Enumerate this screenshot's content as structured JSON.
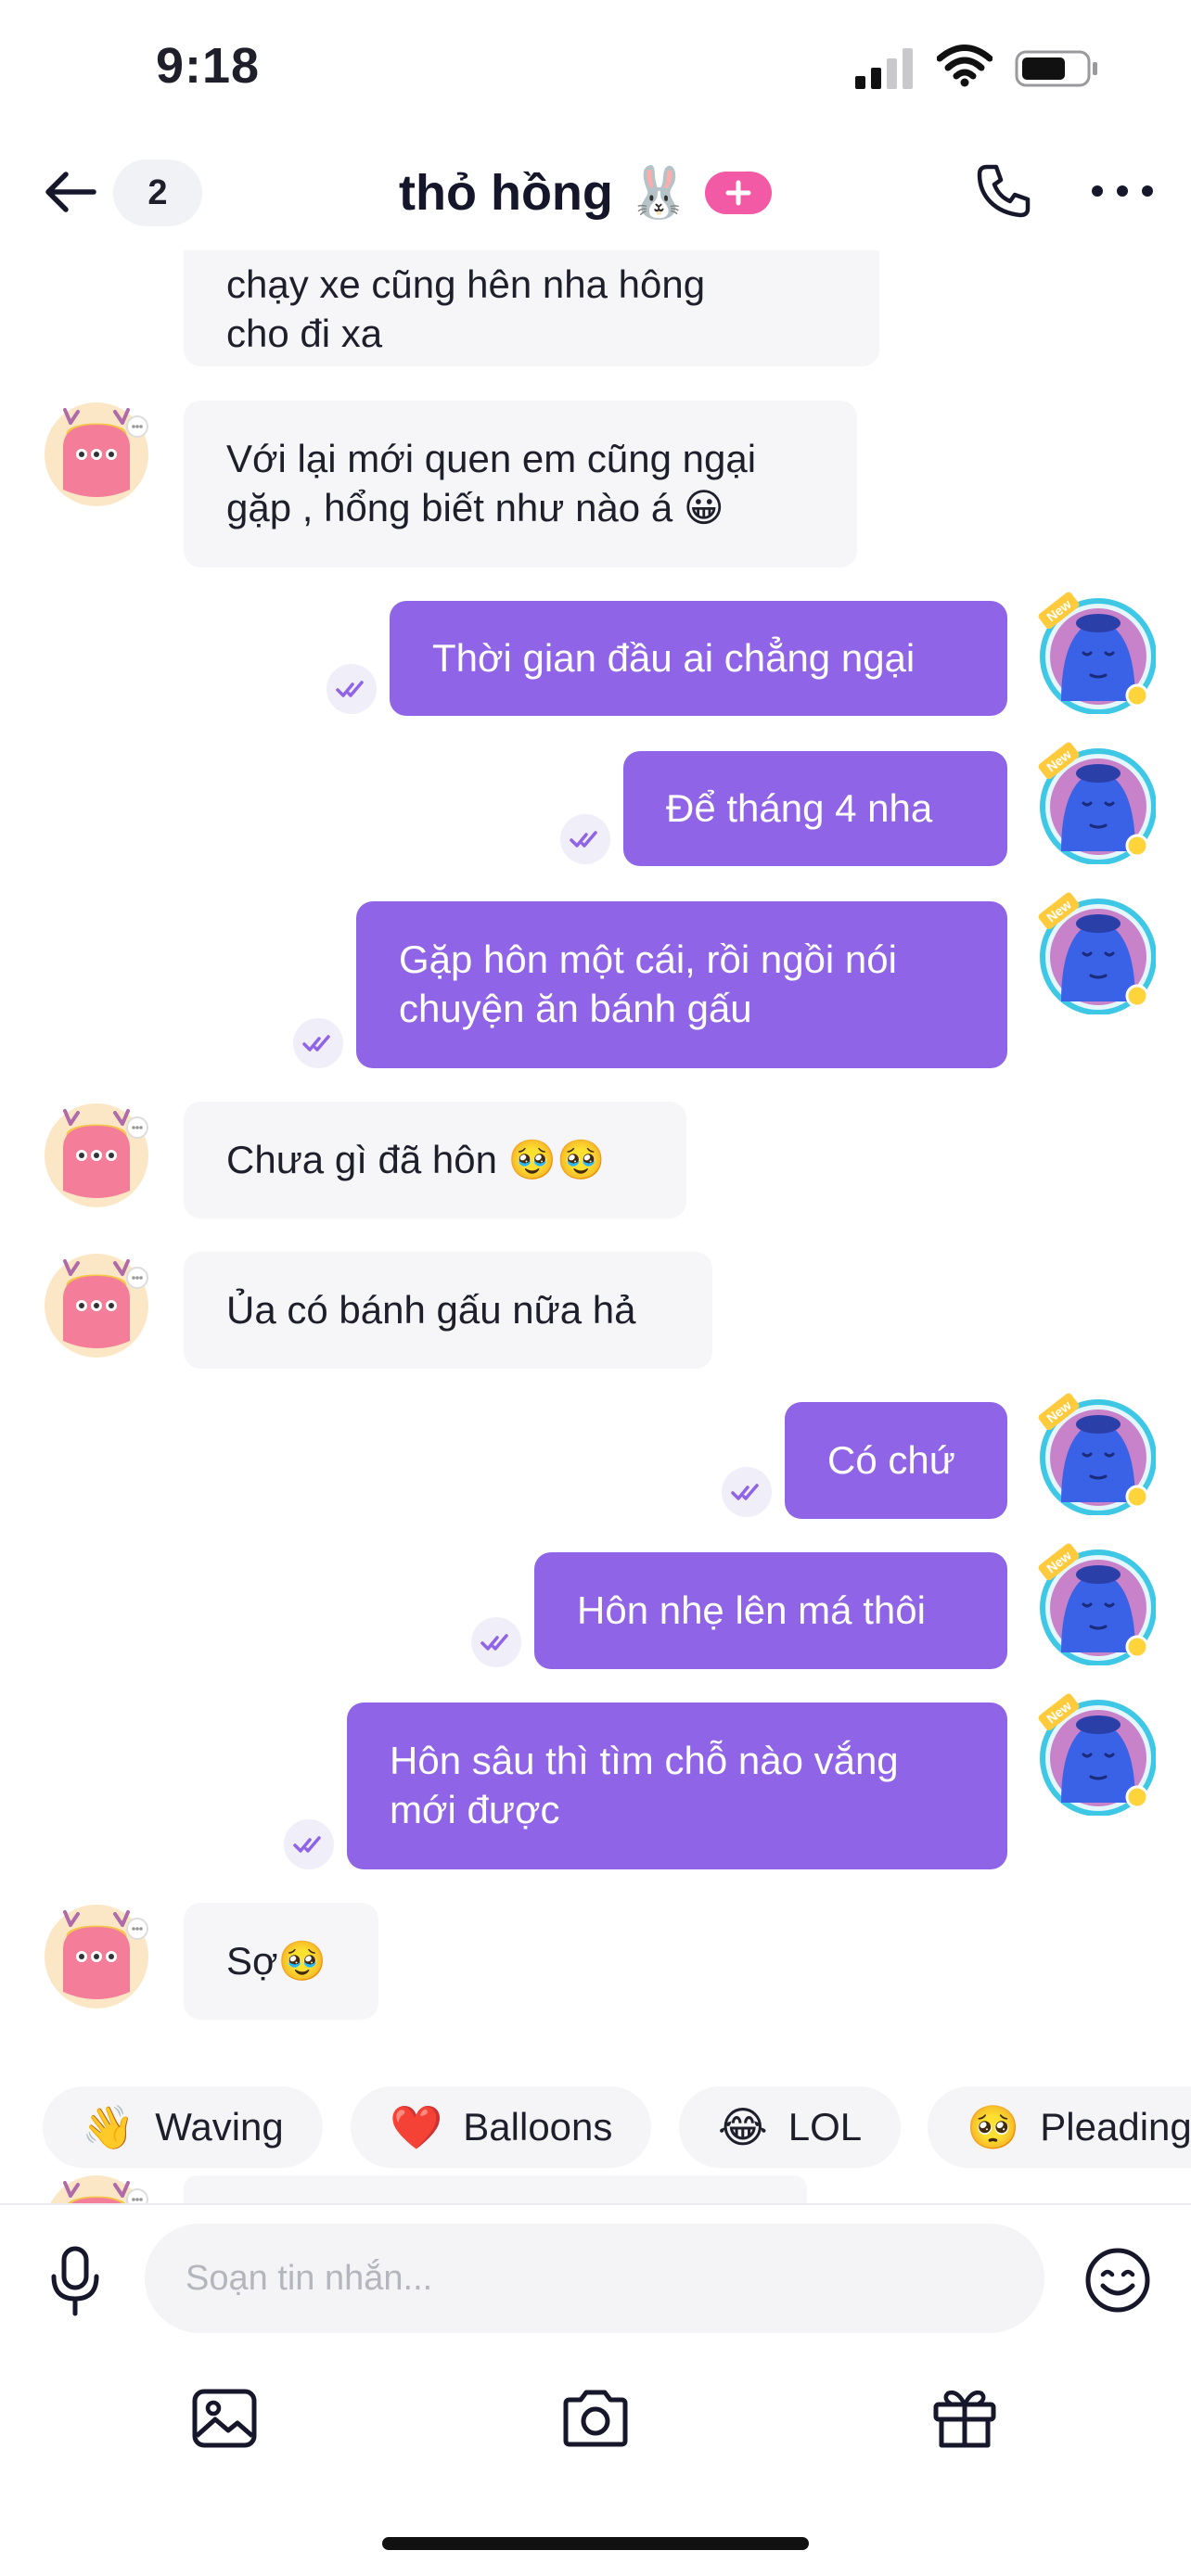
{
  "status_bar": {
    "time": "9:18"
  },
  "header": {
    "back_icon": "arrow-left-icon",
    "unread_count": "2",
    "title": "thỏ hồng",
    "title_emoji": "🐰",
    "add_icon": "plus-icon",
    "call_icon": "phone-icon",
    "more_icon": "more-dots-icon"
  },
  "messages": [
    {
      "direction": "in",
      "lines": [
        "chạy xe cũng hên nha hông",
        "cho đi xa"
      ]
    },
    {
      "direction": "in",
      "lines": [
        "Với lại mới quen em cũng ngại",
        "gặp , hổng biết như nào á 😀"
      ]
    },
    {
      "direction": "out",
      "lines": [
        "Thời gian đầu ai chẳng ngại"
      ]
    },
    {
      "direction": "out",
      "lines": [
        "Để tháng 4 nha"
      ]
    },
    {
      "direction": "out",
      "lines": [
        "Gặp hôn một cái, rồi ngồi nói",
        "chuyện ăn bánh gấu"
      ]
    },
    {
      "direction": "in",
      "lines": [
        "Chưa gì đã hôn 🥹🥹"
      ]
    },
    {
      "direction": "in",
      "lines": [
        "Ủa có bánh gấu nữa hả"
      ]
    },
    {
      "direction": "out",
      "lines": [
        "Có chứ"
      ]
    },
    {
      "direction": "out",
      "lines": [
        "Hôn nhẹ lên má thôi"
      ]
    },
    {
      "direction": "out",
      "lines": [
        "Hôn sâu thì tìm chỗ nào vắng",
        "mới được"
      ]
    },
    {
      "direction": "in",
      "lines": [
        "Sợ🥹"
      ]
    }
  ],
  "avatar_badge": "New",
  "quick_reactions": [
    {
      "emoji": "👋",
      "label": "Waving"
    },
    {
      "emoji": "❤️",
      "label": "Balloons"
    },
    {
      "emoji": "😂",
      "label": "LOL"
    },
    {
      "emoji": "🥺",
      "label": "Pleading"
    }
  ],
  "composer": {
    "placeholder": "Soạn tin nhắn...",
    "value": "",
    "mic_icon": "microphone-icon",
    "emoji_icon": "smiley-icon",
    "gallery_icon": "image-icon",
    "camera_icon": "camera-icon",
    "gift_icon": "gift-icon"
  },
  "colors": {
    "outgoing_bubble": "#8f64e6",
    "incoming_bubble": "#f6f6f8",
    "accent_pink": "#f35aa6",
    "avatar_ring": "#3fc8e6"
  }
}
